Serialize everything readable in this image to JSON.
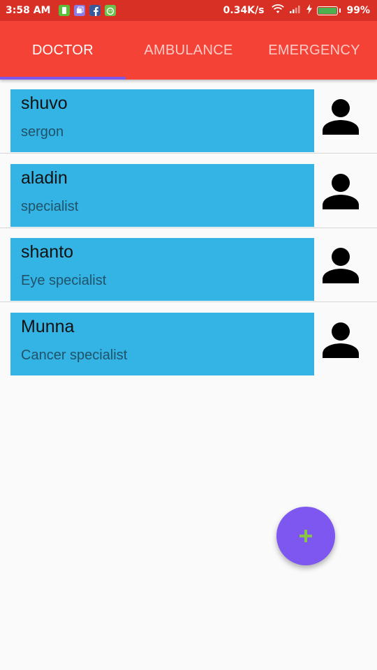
{
  "status_bar": {
    "time": "3:58 AM",
    "speed": "0.34K/s",
    "battery_percent": "99%",
    "battery_level": 0.99,
    "notification_icons": [
      "clipboard-icon",
      "app-icon",
      "facebook-icon",
      "android-icon"
    ],
    "right_icons": [
      "wifi-icon",
      "signal-icon",
      "charging-icon",
      "battery-icon"
    ]
  },
  "tabs": [
    {
      "label": "DOCTOR",
      "selected": true
    },
    {
      "label": "AMBULANCE",
      "selected": false
    },
    {
      "label": "EMERGENCY",
      "selected": false
    }
  ],
  "doctors": [
    {
      "name": "shuvo",
      "specialty": "sergon"
    },
    {
      "name": "aladin",
      "specialty": "specialist"
    },
    {
      "name": "shanto",
      "specialty": "Eye specialist"
    },
    {
      "name": "Munna",
      "specialty": "Cancer specialist"
    }
  ],
  "fab": {
    "icon": "plus-icon"
  },
  "colors": {
    "status_bar": "#d93026",
    "tab_bar": "#f44336",
    "tab_indicator": "#7e57e8",
    "card": "#33b4e4",
    "fab": "#7e57f0",
    "fab_icon": "#8bc34a"
  }
}
